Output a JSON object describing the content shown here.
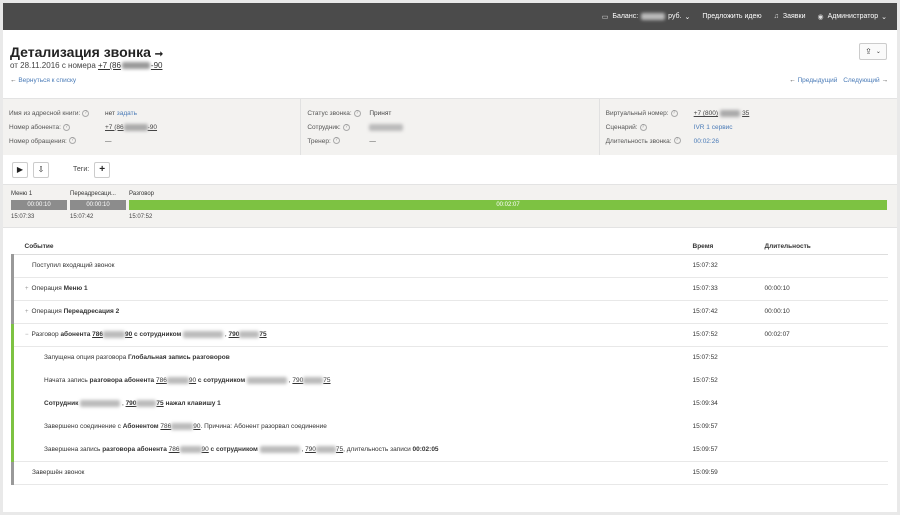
{
  "topbar": {
    "balance_label": "Баланс:",
    "balance_currency": "руб.",
    "suggest": "Предложить идею",
    "requests": "Заявки",
    "admin": "Администратор"
  },
  "header": {
    "title": "Детализация звонка",
    "subtitle_prefix": "от 28.11.2016 с номера",
    "phone_start": "+7 (86",
    "phone_end": "-90",
    "back": "Вернуться к списку",
    "prev": "Предыдущий",
    "next": "Следующий"
  },
  "info": {
    "col1": {
      "name_label": "Имя из адресной книги:",
      "name_value": "нет",
      "name_link": "задать",
      "subscriber_label": "Номер абонента:",
      "subscriber_start": "+7 (86",
      "subscriber_end": "-90",
      "request_label": "Номер обращения:",
      "request_value": "—"
    },
    "col2": {
      "status_label": "Статус звонка:",
      "status_value": "Принят",
      "employee_label": "Сотрудник:",
      "trainer_label": "Тренер:",
      "trainer_value": "—"
    },
    "col3": {
      "virtual_label": "Виртуальный номер:",
      "virtual_start": "+7 (800)",
      "virtual_end": "35",
      "scenario_label": "Сценарий:",
      "scenario_value": "IVR 1 сервис",
      "duration_label": "Длительность звонка:",
      "duration_value": "00:02:26"
    }
  },
  "controls": {
    "tags_label": "Теги:"
  },
  "timeline": {
    "segments": [
      {
        "name": "Меню 1",
        "duration": "00:00:10",
        "start": "15:07:33"
      },
      {
        "name": "Переадресаци...",
        "duration": "00:00:10",
        "start": "15:07:42"
      },
      {
        "name": "Разговор",
        "duration": "00:02:07",
        "start": "15:07:52"
      }
    ]
  },
  "table": {
    "headers": {
      "event": "Событие",
      "time": "Время",
      "duration": "Длительность"
    },
    "rows": {
      "r1": {
        "text": "Поступил входящий звонок",
        "time": "15:07:32",
        "duration": ""
      },
      "r2": {
        "pre": "Операция",
        "bold": "Меню 1",
        "time": "15:07:33",
        "duration": "00:00:10"
      },
      "r3": {
        "pre": "Операция",
        "bold": "Переадресация 2",
        "time": "15:07:42",
        "duration": "00:00:10"
      },
      "r4": {
        "pre": "Разговор",
        "bold1": "абонента",
        "num1a": "786",
        "num1b": "90",
        "mid": "с сотрудником",
        "num2a": "790",
        "num2b": "75",
        "time": "15:07:52",
        "duration": "00:02:07"
      },
      "r5": {
        "pre": "Запущена опция разговора",
        "bold": "Глобальная запись разговоров",
        "time": "15:07:52"
      },
      "r6": {
        "pre": "Начата запись",
        "bold1": "разговора абонента",
        "num1a": "786",
        "num1b": "90",
        "bold2": "с сотрудником",
        "num2a": "790",
        "num2b": "75",
        "time": "15:07:52"
      },
      "r7": {
        "bold1": "Сотрудник",
        "num2a": "790",
        "num2b": "75",
        "bold2": "нажал клавишу 1",
        "time": "15:09:34"
      },
      "r8": {
        "pre": "Завершено соединение с",
        "bold1": "Абонентом",
        "num1a": "786",
        "num1b": "90",
        "post": ". Причина: Абонент разорвал соединение",
        "time": "15:09:57"
      },
      "r9": {
        "pre": "Завершена запись",
        "bold1": "разговора абонента",
        "num1a": "786",
        "num1b": "90",
        "bold2": "с сотрудником",
        "num2a": "790",
        "num2b": "75",
        "post": ", длительность записи",
        "post_bold": "00:02:05",
        "time": "15:09:57"
      },
      "r10": {
        "text": "Завершён звонок",
        "time": "15:09:59",
        "duration": ""
      }
    }
  },
  "colors": {
    "talk_green": "#7dc242",
    "segment_gray": "#8c8c8c",
    "link_blue": "#4a7bb7"
  }
}
